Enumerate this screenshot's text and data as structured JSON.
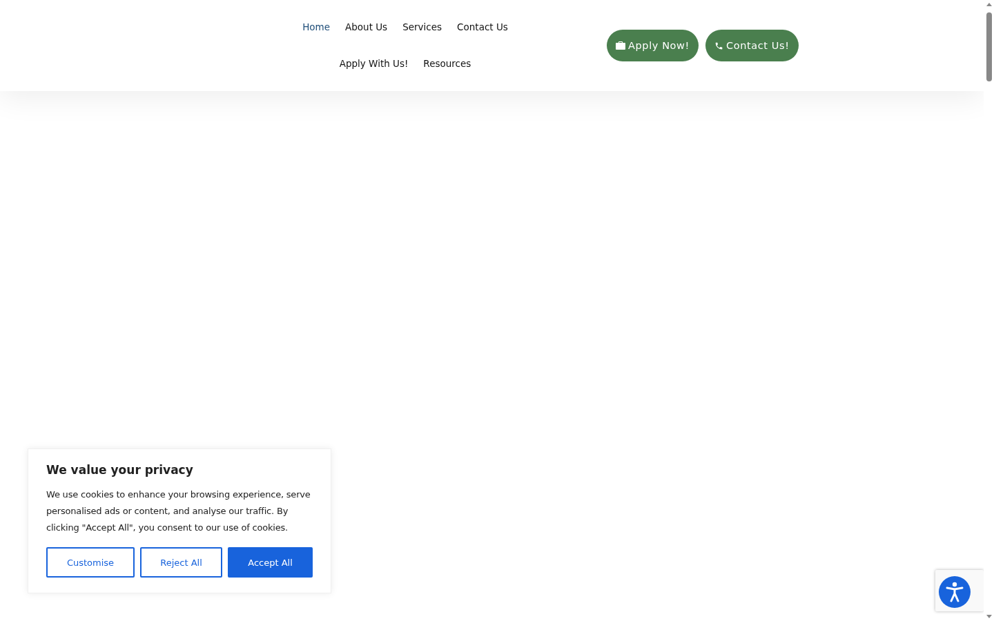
{
  "nav": {
    "items": [
      {
        "label": "Home",
        "selected": true
      },
      {
        "label": "About Us",
        "selected": false
      },
      {
        "label": "Services",
        "selected": false
      },
      {
        "label": "Contact Us",
        "selected": false
      },
      {
        "label": "Apply With Us!",
        "selected": false
      },
      {
        "label": "Resources",
        "selected": false
      }
    ]
  },
  "header_buttons": [
    {
      "label": "Apply Now!",
      "kind": "briefcase"
    },
    {
      "label": "Contact Us!",
      "kind": "phone"
    }
  ],
  "cookie_banner": {
    "title": "We value your privacy",
    "text": "We use cookies to enhance your browsing experience, serve personalised ads or content, and analyse our traffic. By clicking \"Accept All\", you consent to our use of cookies.",
    "buttons": [
      {
        "label": "Customise",
        "kind": "outline"
      },
      {
        "label": "Reject All",
        "kind": "outline"
      },
      {
        "label": "Accept All",
        "kind": "primary"
      }
    ]
  }
}
